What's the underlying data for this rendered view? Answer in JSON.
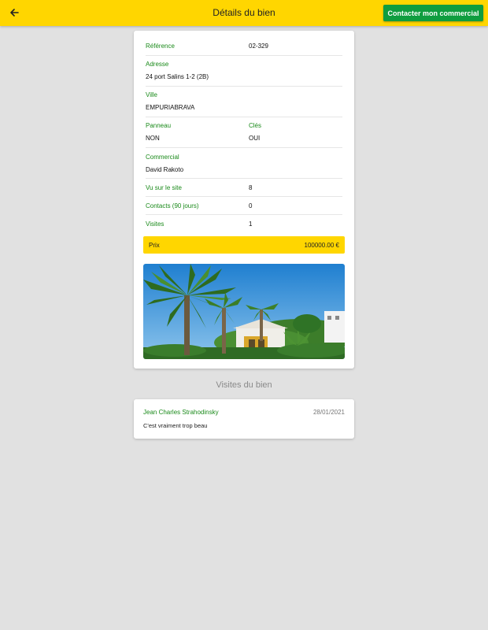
{
  "header": {
    "title": "Détails du bien",
    "contact_label": "Contacter mon commercial"
  },
  "details": {
    "reference": {
      "label": "Référence",
      "value": "02-329"
    },
    "adresse": {
      "label": "Adresse",
      "value": "24 port Salins 1-2 (2B)"
    },
    "ville": {
      "label": "Ville",
      "value": "EMPURIABRAVA"
    },
    "panneau": {
      "label": "Panneau",
      "value": "NON"
    },
    "cles": {
      "label": "Clés",
      "value": "OUI"
    },
    "commercial": {
      "label": "Commercial",
      "value": "David Rakoto"
    },
    "vu": {
      "label": "Vu sur le site",
      "value": "8"
    },
    "contacts": {
      "label": "Contacts (90 jours)",
      "value": "0"
    },
    "visites": {
      "label": "Visites",
      "value": "1"
    }
  },
  "price": {
    "label": "Prix",
    "value": "100000.00 €"
  },
  "visits_section": {
    "title": "Visites du bien",
    "items": [
      {
        "name": "Jean Charles Strahodinsky",
        "date": "28/01/2021",
        "comment": "C'est vraiment trop beau"
      }
    ]
  },
  "colors": {
    "accent": "#ffd600",
    "button": "#0f9d3f",
    "label_green": "#1a8a1a"
  },
  "icons": {
    "back": "arrow-left-icon"
  }
}
